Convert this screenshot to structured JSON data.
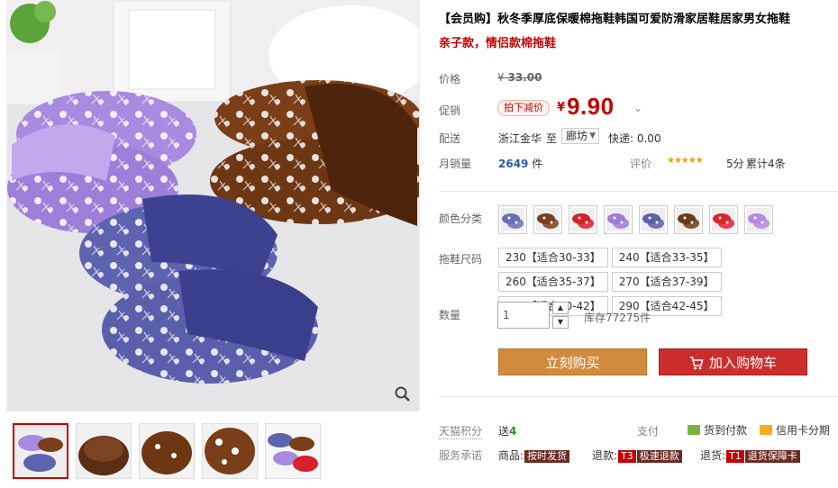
{
  "product": {
    "title": "【会员购】秋冬季厚底保暖棉拖鞋韩国可爱防滑家居鞋居家男女拖鞋",
    "subtitle": "亲子款，情侣款棉拖鞋"
  },
  "price": {
    "label": "价格",
    "currency": "¥",
    "original": "33.00"
  },
  "promo": {
    "label": "促销",
    "tag": "拍下减价",
    "currency": "¥",
    "price": "9.90"
  },
  "shipping": {
    "label": "配送",
    "from": "浙江金华",
    "to": "至",
    "destination": "廊坊",
    "express": "快递: 0.00"
  },
  "sales": {
    "label": "月销量",
    "count": "2649",
    "unit": "件"
  },
  "rating": {
    "label": "评价",
    "stars": "★★★★★",
    "score": "5分",
    "reviews": "累计4条"
  },
  "colors": {
    "label": "颜色分类",
    "swatches": [
      {
        "name": "blue-1",
        "color": "#6a6fb5"
      },
      {
        "name": "brown-1",
        "color": "#7b3f1b"
      },
      {
        "name": "red-1",
        "color": "#d8202a"
      },
      {
        "name": "purple-1",
        "color": "#a07ad8"
      },
      {
        "name": "blue-2",
        "color": "#5a62a8"
      },
      {
        "name": "brown-2",
        "color": "#6f3a1a"
      },
      {
        "name": "red-2",
        "color": "#e02330"
      },
      {
        "name": "purple-2",
        "color": "#b48be0"
      }
    ]
  },
  "sizes": {
    "label": "拖鞋尺码",
    "options": [
      "230【适合30-33】",
      "240【适合33-35】",
      "260【适合35-37】",
      "270【适合37-39】",
      "280【适合40-42】",
      "290【适合42-45】"
    ]
  },
  "quantity": {
    "label": "数量",
    "value": "1",
    "stock": "库存77275件"
  },
  "actions": {
    "buy_now": "立刻购买",
    "add_to_cart": "加入购物车"
  },
  "points": {
    "label": "天猫积分",
    "prefix": "送",
    "value": "4"
  },
  "payment": {
    "label": "支付",
    "cod": "货到付款",
    "card": "信用卡分期"
  },
  "services": {
    "label": "服务承诺",
    "goods_prefix": "商品:",
    "goods_tag": "按时发货",
    "refund_prefix": "退款:",
    "refund_tag_code": "T3",
    "refund_tag": "极速退款",
    "return_prefix": "退货:",
    "return_tag_code": "T1",
    "return_tag": "退货保障卡"
  },
  "icons": {
    "zoom": "magnifier-icon",
    "cart": "cart-icon"
  }
}
